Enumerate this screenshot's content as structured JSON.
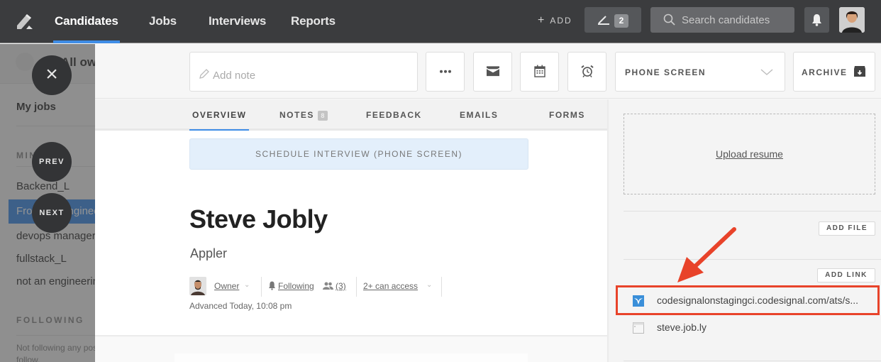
{
  "nav": {
    "tabs": [
      {
        "label": "Candidates",
        "active": true
      },
      {
        "label": "Jobs"
      },
      {
        "label": "Interviews"
      },
      {
        "label": "Reports"
      }
    ],
    "add_label": "ADD",
    "add_symbol": "+",
    "notes_count": "2",
    "search_placeholder": "Search candidates",
    "accent_color": "#3f8de6"
  },
  "sidebar": {
    "header_label": "All owners",
    "my_jobs": "My jobs",
    "mine_section": "MINE",
    "items": [
      {
        "label": "Backend_L"
      },
      {
        "label": "Frontend engineer",
        "active": true
      },
      {
        "label": "devops manager"
      },
      {
        "label": "fullstack_L"
      },
      {
        "label": "not an engineering"
      }
    ],
    "following_section": "FOLLOWING",
    "following_note": "Not following any postings",
    "following_note2": "follow."
  },
  "overlay": {
    "close_symbol": "×",
    "prev_label": "PREV",
    "next_label": "NEXT"
  },
  "toolbar": {
    "add_note_placeholder": "Add note",
    "stage_value": "PHONE SCREEN",
    "archive_label": "ARCHIVE"
  },
  "tabs": [
    {
      "label": "OVERVIEW",
      "active": true
    },
    {
      "label": "NOTES",
      "badge": "8"
    },
    {
      "label": "FEEDBACK"
    },
    {
      "label": "EMAILS"
    },
    {
      "label": "FORMS"
    }
  ],
  "overview": {
    "schedule_label": "SCHEDULE INTERVIEW (PHONE SCREEN)",
    "candidate_name": "Steve Jobly",
    "candidate_org": "Appler",
    "owner_label": "Owner",
    "following_label": "Following",
    "followers_count": "(3)",
    "access_label": "2+ can access",
    "advanced_text": "Advanced Today, 10:08 pm"
  },
  "right_panel": {
    "upload_resume": "Upload resume",
    "add_file": "ADD FILE",
    "add_link": "ADD LINK",
    "links": [
      {
        "icon": "codesignal-icon",
        "text": "codesignalonstagingci.codesignal.com/ats/s...",
        "highlighted": true
      },
      {
        "icon": "webpage-icon",
        "text": "steve.job.ly"
      }
    ],
    "highlight_color": "#e8432a"
  }
}
